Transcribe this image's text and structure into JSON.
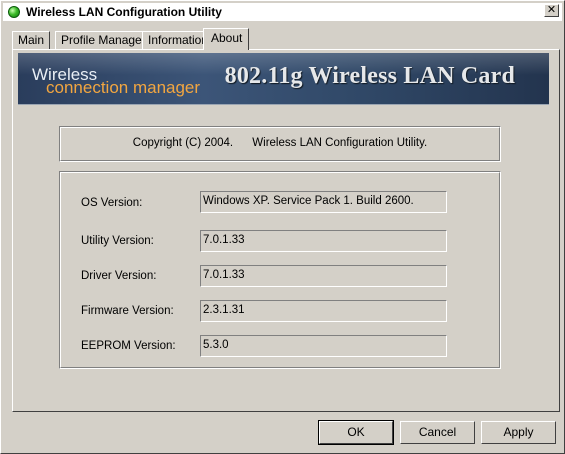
{
  "window": {
    "title": "Wireless LAN Configuration Utility",
    "close_glyph": "✕"
  },
  "tabs": [
    {
      "label": "Main"
    },
    {
      "label": "Profile Manager"
    },
    {
      "label": "Information"
    },
    {
      "label": "About"
    }
  ],
  "active_tab": "About",
  "banner": {
    "line1": "Wireless",
    "line2": "connection manager",
    "product": "802.11g Wireless LAN Card"
  },
  "copyright": {
    "text": "Copyright (C) 2004.      Wireless LAN Configuration Utility."
  },
  "versions": [
    {
      "label": "OS Version:",
      "value": "Windows XP. Service Pack 1. Build 2600."
    },
    {
      "label": "Utility Version:",
      "value": "7.0.1.33"
    },
    {
      "label": "Driver Version:",
      "value": "7.0.1.33"
    },
    {
      "label": "Firmware Version:",
      "value": "2.3.1.31"
    },
    {
      "label": "EEPROM Version:",
      "value": "5.3.0"
    }
  ],
  "buttons": {
    "ok": "OK",
    "cancel": "Cancel",
    "apply": "Apply"
  },
  "colors": {
    "window_bg": "#d4d0c8",
    "banner_bg": "#304867",
    "banner_accent": "#f2a640",
    "app_icon": "#3dbb2a"
  }
}
